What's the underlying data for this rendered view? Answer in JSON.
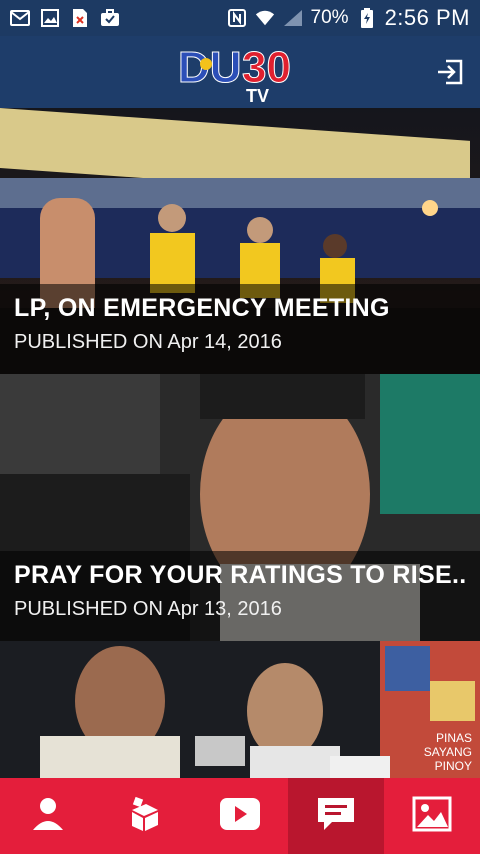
{
  "status_bar": {
    "icons": [
      "mail-icon",
      "image-icon",
      "file-error-icon",
      "briefcase-check-icon"
    ],
    "right_icons": [
      "nfc-icon",
      "wifi-icon",
      "signal-icon"
    ],
    "battery": "70%",
    "time": "2:56 PM"
  },
  "header": {
    "logo_text": "DU30",
    "logo_sub": "TV",
    "logout_icon": "logout-icon"
  },
  "feed": {
    "items": [
      {
        "title": "LP, ON EMERGENCY MEETING",
        "date": "PUBLISHED ON Apr 14, 2016"
      },
      {
        "title": "PRAY FOR YOUR RATINGS TO RISE...",
        "date": "PUBLISHED ON Apr 13, 2016"
      },
      {
        "title": "",
        "date": ""
      }
    ],
    "third_banner_text": [
      "PINAS",
      "SAYANG",
      "PINOY"
    ]
  },
  "bottom_nav": {
    "items": [
      "profile-icon",
      "box-icon",
      "video-play-icon",
      "chat-icon",
      "gallery-icon"
    ],
    "active": "chat-icon"
  },
  "colors": {
    "header_bg": "#1e3d6a",
    "nav_bg": "#e41e3b",
    "nav_active": "#b9162e"
  }
}
